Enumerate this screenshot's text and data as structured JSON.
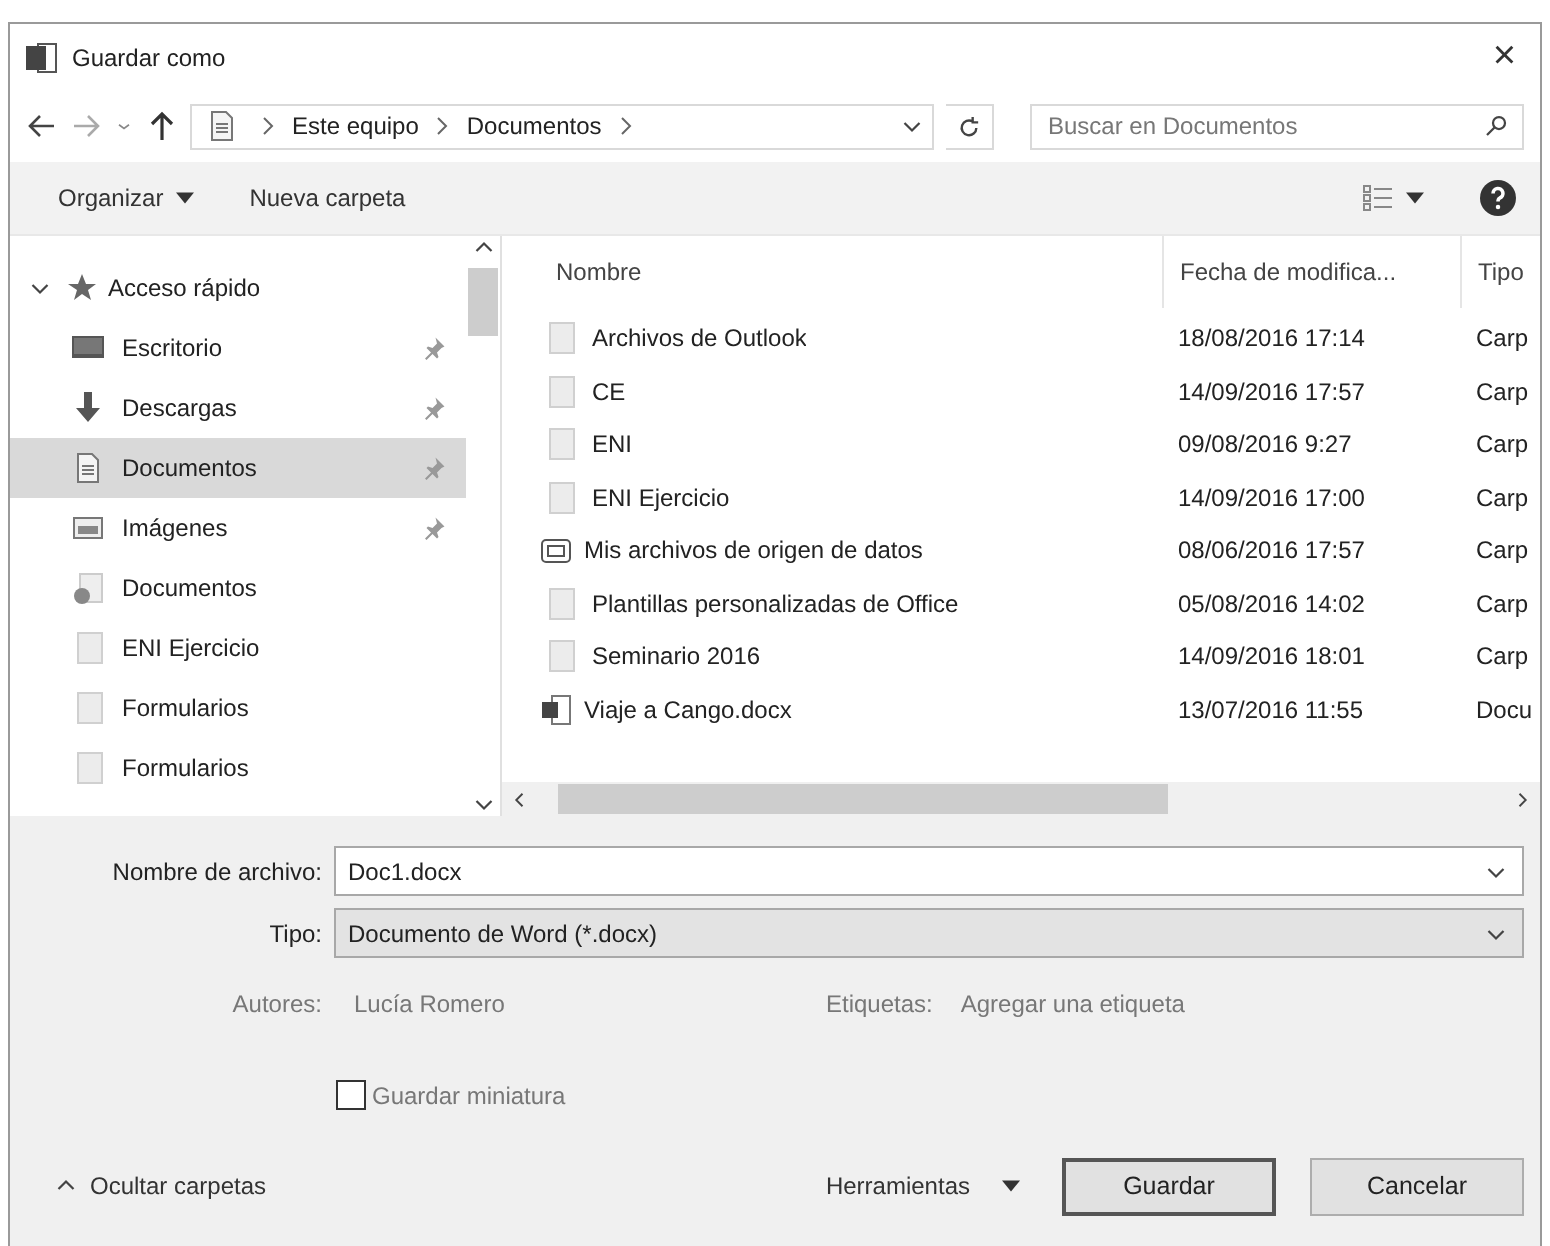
{
  "window": {
    "title": "Guardar como",
    "close": "×"
  },
  "address": {
    "crumbs": [
      "Este equipo",
      "Documentos"
    ],
    "search_placeholder": "Buscar en Documentos"
  },
  "toolbar": {
    "organize": "Organizar",
    "new_folder": "Nueva carpeta"
  },
  "sidebar": {
    "items": [
      {
        "label": "Acceso rápido",
        "kind": "star",
        "expanded": true,
        "selected": false,
        "children": [
          {
            "label": "Escritorio",
            "kind": "desktop",
            "pinned": true,
            "selected": false
          },
          {
            "label": "Descargas",
            "kind": "download",
            "pinned": true,
            "selected": false
          },
          {
            "label": "Documentos",
            "kind": "documents",
            "pinned": true,
            "selected": true
          },
          {
            "label": "Imágenes",
            "kind": "images",
            "pinned": true,
            "selected": false
          },
          {
            "label": "Documentos",
            "kind": "synced",
            "pinned": false,
            "selected": false
          },
          {
            "label": "ENI Ejercicio",
            "kind": "folder",
            "pinned": false,
            "selected": false
          },
          {
            "label": "Formularios",
            "kind": "folder",
            "pinned": false,
            "selected": false
          },
          {
            "label": "Formularios",
            "kind": "folder",
            "pinned": false,
            "selected": false
          }
        ]
      }
    ]
  },
  "table": {
    "columns": [
      "Nombre",
      "Fecha de modifica...",
      "Tipo"
    ],
    "rows": [
      {
        "kind": "folder",
        "name": "Archivos de Outlook",
        "date": "18/08/2016 17:14",
        "type": "Carp"
      },
      {
        "kind": "folder",
        "name": "CE",
        "date": "14/09/2016 17:57",
        "type": "Carp"
      },
      {
        "kind": "folder",
        "name": "ENI",
        "date": "09/08/2016 9:27",
        "type": "Carp"
      },
      {
        "kind": "folder",
        "name": "ENI Ejercicio",
        "date": "14/09/2016 17:00",
        "type": "Carp"
      },
      {
        "kind": "datasource",
        "name": "Mis archivos de origen de datos",
        "date": "08/06/2016 17:57",
        "type": "Carp"
      },
      {
        "kind": "folder",
        "name": "Plantillas personalizadas de Office",
        "date": "05/08/2016 14:02",
        "type": "Carp"
      },
      {
        "kind": "folder",
        "name": "Seminario 2016",
        "date": "14/09/2016 18:01",
        "type": "Carp"
      },
      {
        "kind": "word",
        "name": "Viaje a Cango.docx",
        "date": "13/07/2016 11:55",
        "type": "Docu"
      }
    ]
  },
  "form": {
    "file_name_label": "Nombre de archivo:",
    "file_name": "Doc1.docx",
    "type_label": "Tipo:",
    "type_value": "Documento de Word (*.docx)",
    "authors_label": "Autores:",
    "authors": "Lucía Romero",
    "tags_label": "Etiquetas:",
    "tags_placeholder": "Agregar una etiqueta",
    "thumbnail": {
      "label": "Guardar miniatura",
      "checked": false
    }
  },
  "footer": {
    "hide_folders": "Ocultar carpetas",
    "tools": "Herramientas",
    "save": "Guardar",
    "cancel": "Cancelar"
  }
}
